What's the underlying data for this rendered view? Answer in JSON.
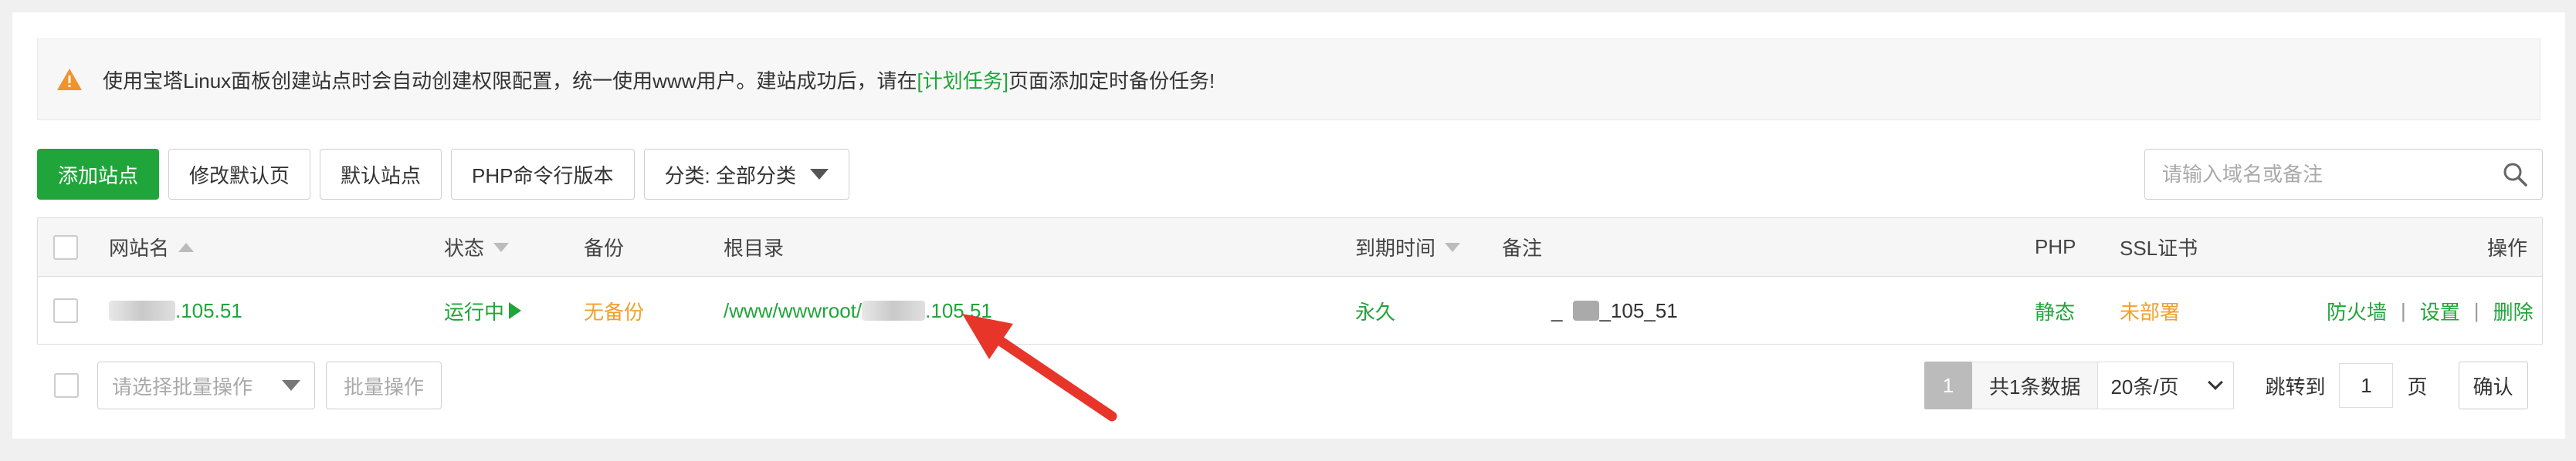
{
  "alert": {
    "text_before": "使用宝塔Linux面板创建站点时会自动创建权限配置，统一使用www用户。建站成功后，请在",
    "link": "[计划任务]",
    "text_after": "页面添加定时备份任务!"
  },
  "toolbar": {
    "add_site": "添加站点",
    "modify_default_page": "修改默认页",
    "default_site": "默认站点",
    "php_cli_version": "PHP命令行版本",
    "category": "分类: 全部分类"
  },
  "search": {
    "placeholder": "请输入域名或备注"
  },
  "table": {
    "headers": {
      "site_name": "网站名",
      "status": "状态",
      "backup": "备份",
      "root_dir": "根目录",
      "expire": "到期时间",
      "remark": "备注",
      "php": "PHP",
      "ssl": "SSL证书",
      "actions": "操作"
    },
    "rows": [
      {
        "site_name_suffix": ".105.51",
        "status": "运行中",
        "backup": "无备份",
        "root_dir_prefix": "/www/wwwroot/",
        "root_dir_suffix": ".105.51",
        "expire": "永久",
        "remark_prefix": "_",
        "remark_suffix": "_105_51",
        "php": "静态",
        "ssl": "未部署",
        "action_firewall": "防火墙",
        "action_settings": "设置",
        "action_delete": "删除",
        "separator": "|"
      }
    ]
  },
  "batch": {
    "select_placeholder": "请选择批量操作",
    "button": "批量操作"
  },
  "pagination": {
    "current_page": "1",
    "total": "共1条数据",
    "per_page": "20条/页",
    "jump_label": "跳转到",
    "jump_value": "1",
    "page_unit": "页",
    "confirm": "确认"
  },
  "colors": {
    "accent": "#20a53a",
    "warning": "#f0a030",
    "annotation_arrow": "#e8352a"
  },
  "icons": {
    "alert": "warning-triangle-icon",
    "search": "search-icon",
    "annotation": "red-arrow-annotation"
  }
}
